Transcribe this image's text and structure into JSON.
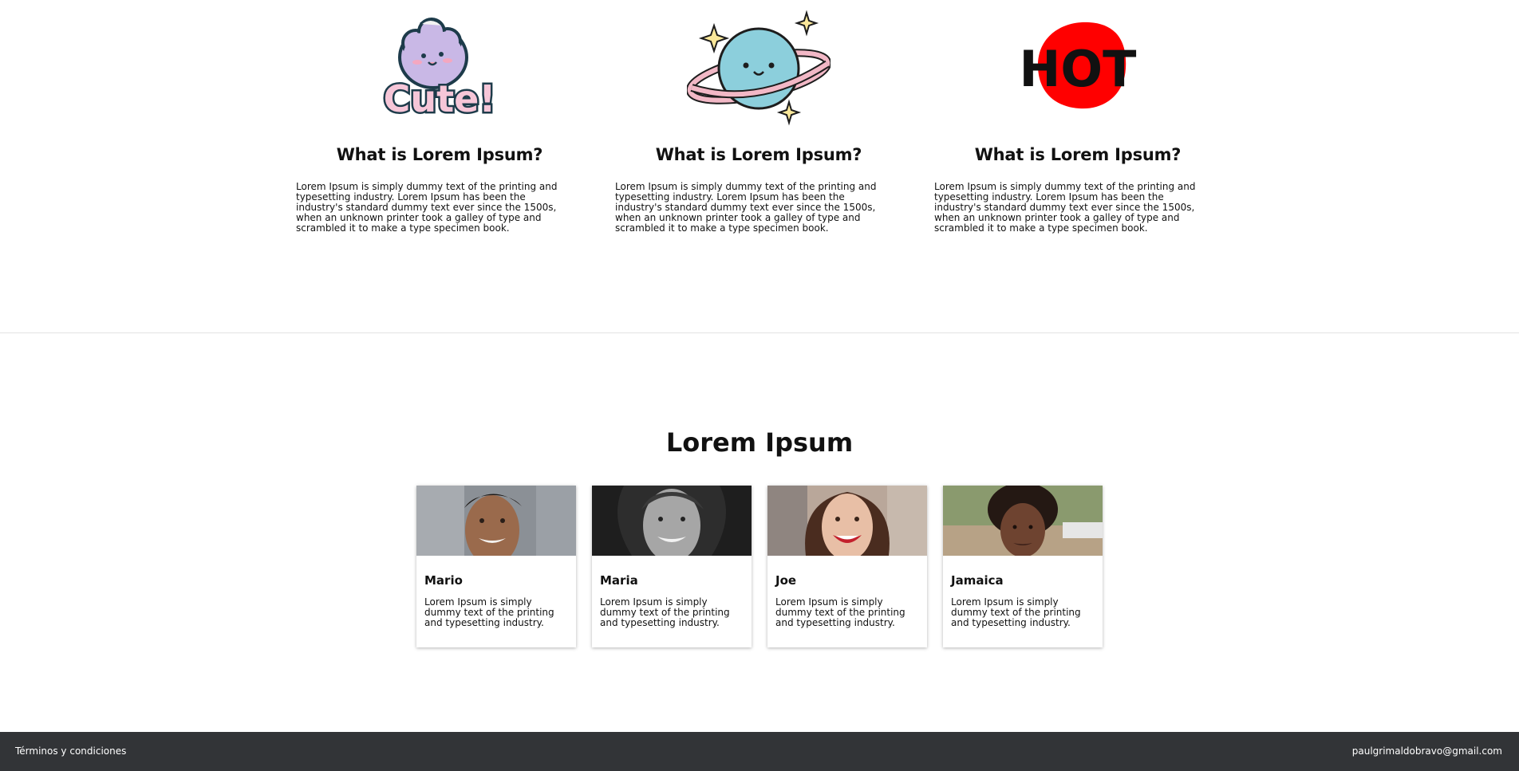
{
  "features": [
    {
      "icon": "cute-sticker",
      "sticker_text": "Cute!",
      "title": "What is Lorem Ipsum?",
      "text": "Lorem Ipsum is simply dummy text of the printing and typesetting industry. Lorem Ipsum has been the industry's standard dummy text ever since the 1500s, when an unknown printer took a galley of type and scrambled it to make a type specimen book."
    },
    {
      "icon": "planet-sticker",
      "title": "What is Lorem Ipsum?",
      "text": "Lorem Ipsum is simply dummy text of the printing and typesetting industry. Lorem Ipsum has been the industry's standard dummy text ever since the 1500s, when an unknown printer took a galley of type and scrambled it to make a type specimen book."
    },
    {
      "icon": "hot-sticker",
      "sticker_text": "HOT",
      "title": "What is Lorem Ipsum?",
      "text": "Lorem Ipsum is simply dummy text of the printing and typesetting industry. Lorem Ipsum has been the industry's standard dummy text ever since the 1500s, when an unknown printer took a galley of type and scrambled it to make a type specimen book."
    }
  ],
  "team": {
    "title": "Lorem Ipsum",
    "members": [
      {
        "name": "Mario",
        "bio": "Lorem Ipsum is simply dummy text of the printing and typesetting industry.",
        "photo": "avatar-photo"
      },
      {
        "name": "Maria",
        "bio": "Lorem Ipsum is simply dummy text of the printing and typesetting industry.",
        "photo": "avatar-photo-bw"
      },
      {
        "name": "Joe",
        "bio": "Lorem Ipsum is simply dummy text of the printing and typesetting industry.",
        "photo": "avatar-photo"
      },
      {
        "name": "Jamaica",
        "bio": "Lorem Ipsum is simply dummy text of the printing and typesetting industry.",
        "photo": "avatar-photo"
      }
    ]
  },
  "footer": {
    "terms": "Términos y condiciones",
    "email": "paulgrimaldobravo@gmail.com"
  },
  "colors": {
    "footer_bg": "#323437",
    "hot_red": "#ff0000",
    "planet_blue": "#8ccfdc",
    "ring_pink": "#f2b8c6",
    "cute_lavender": "#c9b8e6"
  }
}
